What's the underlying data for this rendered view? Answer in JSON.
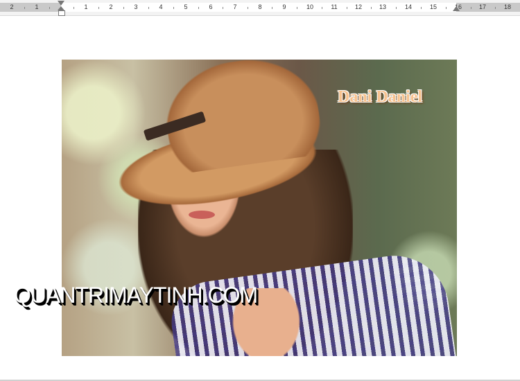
{
  "ruler": {
    "labels": [
      "2",
      "1",
      "1",
      "2",
      "3",
      "4",
      "5",
      "6",
      "7",
      "8",
      "9",
      "10",
      "11",
      "12",
      "13",
      "14",
      "15",
      "16",
      "17",
      "18"
    ]
  },
  "document": {
    "image": {
      "description_label": "",
      "caption": "Dani Daniel",
      "caption_color": "#f7c28e"
    },
    "watermark": "QUANTRIMAYTINH.COM"
  }
}
